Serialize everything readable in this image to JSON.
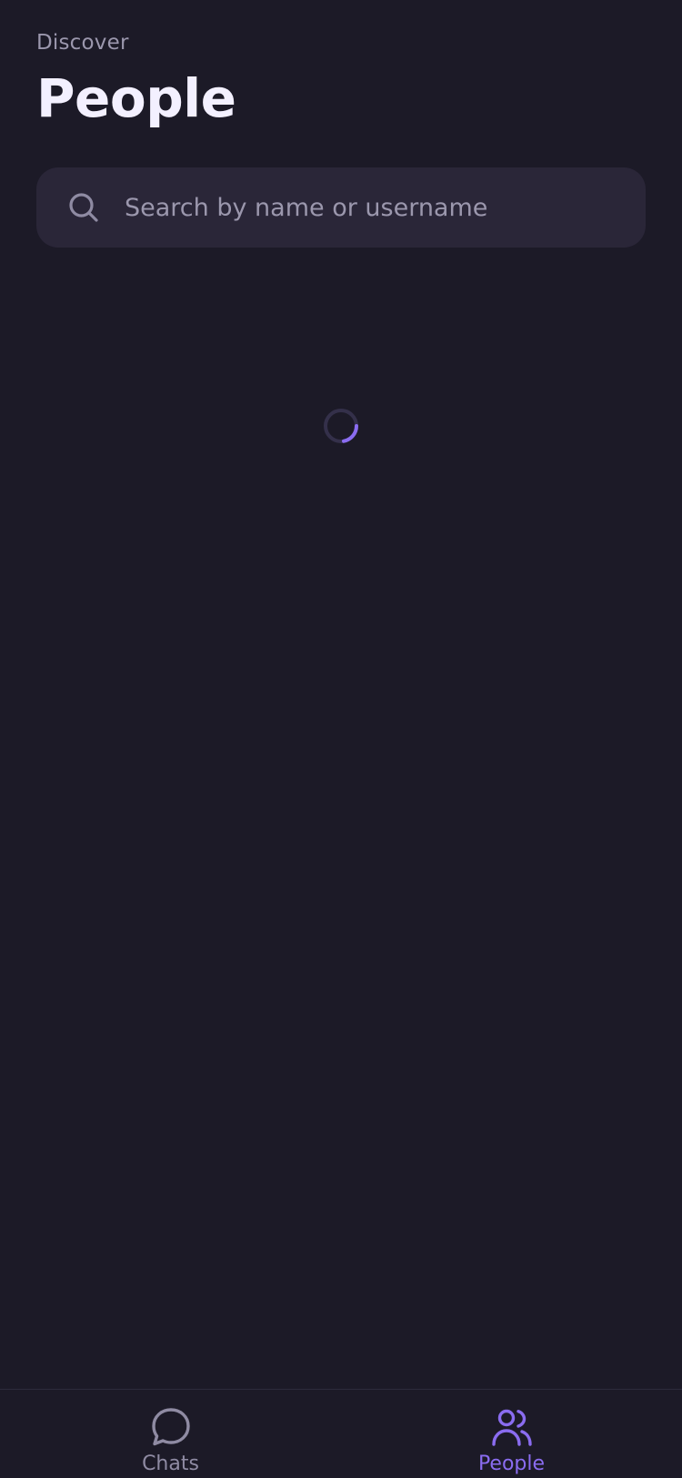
{
  "header": {
    "eyebrow": "Discover",
    "title": "People"
  },
  "search": {
    "placeholder": "Search by name or username",
    "value": "",
    "icon": "search-icon"
  },
  "loading": {
    "icon": "loading-spinner"
  },
  "tabbar": {
    "tabs": [
      {
        "label": "Chats",
        "icon": "chat-bubble-icon",
        "active": false
      },
      {
        "label": "People",
        "icon": "people-icon",
        "active": true
      }
    ]
  },
  "colors": {
    "background": "#1c1a27",
    "surface": "#2a2638",
    "text_primary": "#f3f0ff",
    "text_secondary": "#9b97ad",
    "accent": "#8a6cf0"
  }
}
